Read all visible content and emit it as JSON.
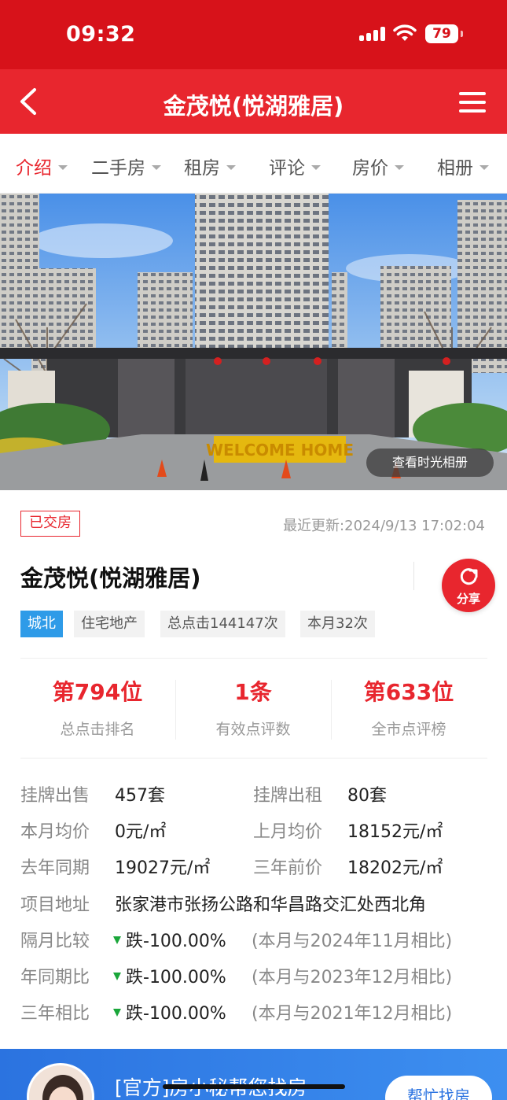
{
  "status_bar": {
    "time": "09:32",
    "battery": "79"
  },
  "nav": {
    "title": "金茂悦(悦湖雅居)"
  },
  "tabs": [
    {
      "label": "介绍",
      "active": true
    },
    {
      "label": "二手房"
    },
    {
      "label": "租房"
    },
    {
      "label": "评论"
    },
    {
      "label": "房价"
    },
    {
      "label": "相册"
    }
  ],
  "hero": {
    "album_button": "查看时光相册",
    "sign_text": "WELCOME HOME"
  },
  "info": {
    "status_badge": "已交房",
    "update_label": "最近更新:",
    "update_time": "2024/9/13 17:02:04",
    "name": "金茂悦(悦湖雅居)",
    "share_label": "分享",
    "tags": [
      "城北",
      "住宅地产",
      "总点击144147次",
      "本月32次"
    ]
  },
  "stats": [
    {
      "value": "第794位",
      "label": "总点击排名"
    },
    {
      "value": "1条",
      "label": "有效点评数"
    },
    {
      "value": "第633位",
      "label": "全市点评榜"
    }
  ],
  "details": {
    "listing_sale_label": "挂牌出售",
    "listing_sale_value": "457套",
    "listing_rent_label": "挂牌出租",
    "listing_rent_value": "80套",
    "month_avg_label": "本月均价",
    "month_avg_value": "0元/㎡",
    "last_month_label": "上月均价",
    "last_month_value": "18152元/㎡",
    "last_year_label": "去年同期",
    "last_year_value": "19027元/㎡",
    "three_year_label": "三年前价",
    "three_year_value": "18202元/㎡",
    "address_label": "项目地址",
    "address_value": "张家港市张扬公路和华昌路交汇处西北角"
  },
  "comparisons": [
    {
      "label": "隔月比较",
      "change": "跌-100.00%",
      "note": "(本月与2024年11月相比)"
    },
    {
      "label": "年同期比",
      "change": "跌-100.00%",
      "note": "(本月与2023年12月相比)"
    },
    {
      "label": "三年相比",
      "change": "跌-100.00%",
      "note": "(本月与2021年12月相比)"
    }
  ],
  "banner": {
    "text": "[官方]房小秘帮您找房",
    "button": "帮忙找房"
  },
  "colors": {
    "brand_red": "#e8262e",
    "tag_blue": "#2e9be8",
    "down_green": "#1aa63a",
    "banner_blue": "#2b73e0"
  }
}
